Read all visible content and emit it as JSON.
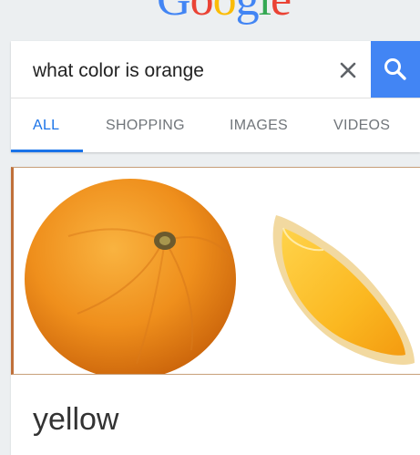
{
  "logo": {
    "letters": [
      "G",
      "o",
      "o",
      "g",
      "l",
      "e"
    ],
    "colors": [
      "#4285f4",
      "#ea4335",
      "#fbbc05",
      "#4285f4",
      "#34a853",
      "#ea4335"
    ]
  },
  "search": {
    "query": "what color is orange",
    "clear_icon": "close-icon",
    "submit_icon": "search-icon",
    "accent": "#4285f4"
  },
  "tabs": [
    {
      "label": "ALL",
      "active": true
    },
    {
      "label": "SHOPPING",
      "active": false
    },
    {
      "label": "IMAGES",
      "active": false
    },
    {
      "label": "VIDEOS",
      "active": false
    }
  ],
  "result": {
    "answer": "yellow"
  }
}
